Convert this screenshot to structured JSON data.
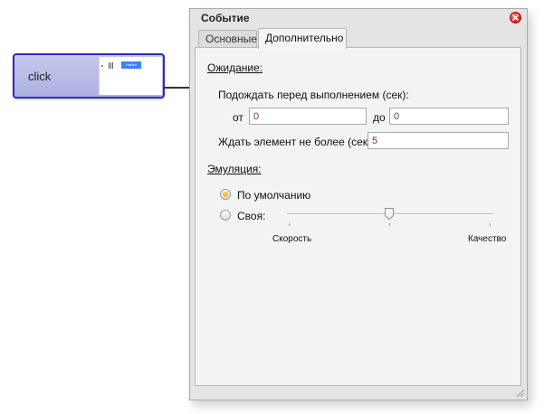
{
  "canvas": {
    "node": {
      "label": "click",
      "thumb_button": "Найти"
    }
  },
  "dialog": {
    "title": "Событие",
    "tabs": [
      {
        "label": "Основные",
        "active": false
      },
      {
        "label": "Дополнительно",
        "active": true
      }
    ],
    "waiting": {
      "section_title": "Ожидание:",
      "wait_before_label": "Подождать перед выполнением (сек):",
      "from_label": "от",
      "from_value": "0",
      "to_label": "до",
      "to_value": "0",
      "wait_element_label": "Ждать элемент не более (сек):",
      "wait_element_value": "5"
    },
    "emulation": {
      "section_title": "Эмуляция:",
      "options": [
        {
          "label": "По умолчанию",
          "selected": true
        },
        {
          "label": "Своя:",
          "selected": false
        }
      ],
      "slider": {
        "min_label": "Скорость",
        "max_label": "Качество",
        "level": 0.5
      }
    }
  },
  "colors": {
    "node_border": "#2a2fb4",
    "node_fill": "#b8b9e6",
    "close_button": "#e0261a",
    "input_text": "#7a2a7a",
    "radio_selected": "#e59a0a"
  }
}
